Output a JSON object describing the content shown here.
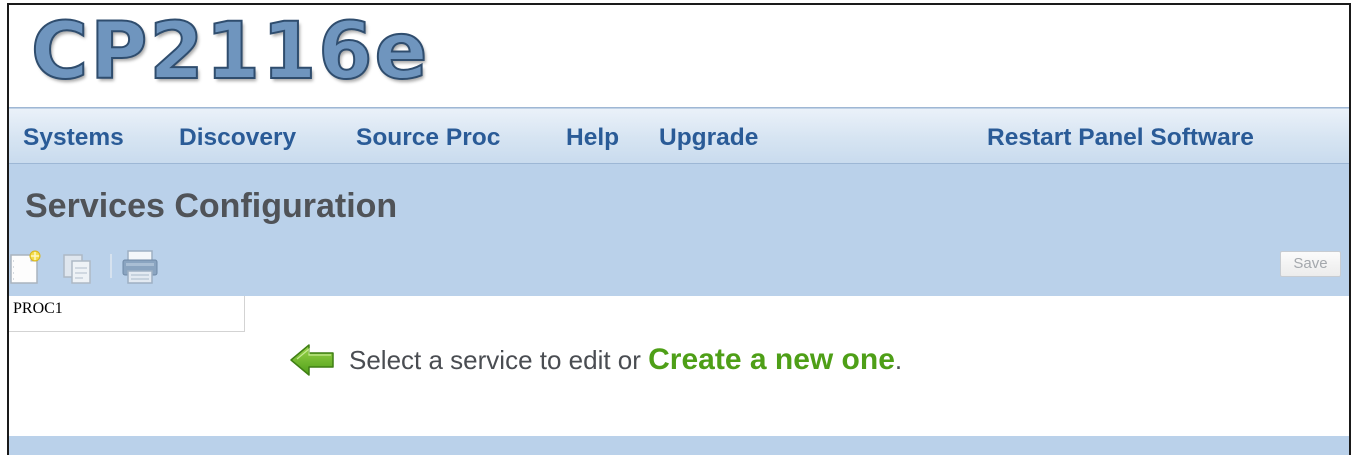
{
  "header": {
    "logo_text": "CP2116e"
  },
  "nav": {
    "items": [
      {
        "label": "Systems"
      },
      {
        "label": "Discovery"
      },
      {
        "label": "Source Proc"
      },
      {
        "label": "Help"
      },
      {
        "label": "Upgrade"
      }
    ],
    "restart_label": "Restart Panel Software"
  },
  "page": {
    "title": "Services Configuration"
  },
  "toolbar": {
    "icons": [
      "new-document-icon",
      "copy-icon",
      "print-icon"
    ],
    "save_label": "Save"
  },
  "services": {
    "items": [
      "PROC1"
    ]
  },
  "prompt": {
    "icon": "green-left-arrow-icon",
    "text_before": "Select a service to edit or ",
    "link": "Create a new one",
    "text_after": "."
  },
  "colors": {
    "nav_text": "#2a5b97",
    "panel_background": "#bad1ea",
    "link_green": "#4e9f17",
    "title_text": "#505358",
    "logo_fill": "#6f95be"
  }
}
